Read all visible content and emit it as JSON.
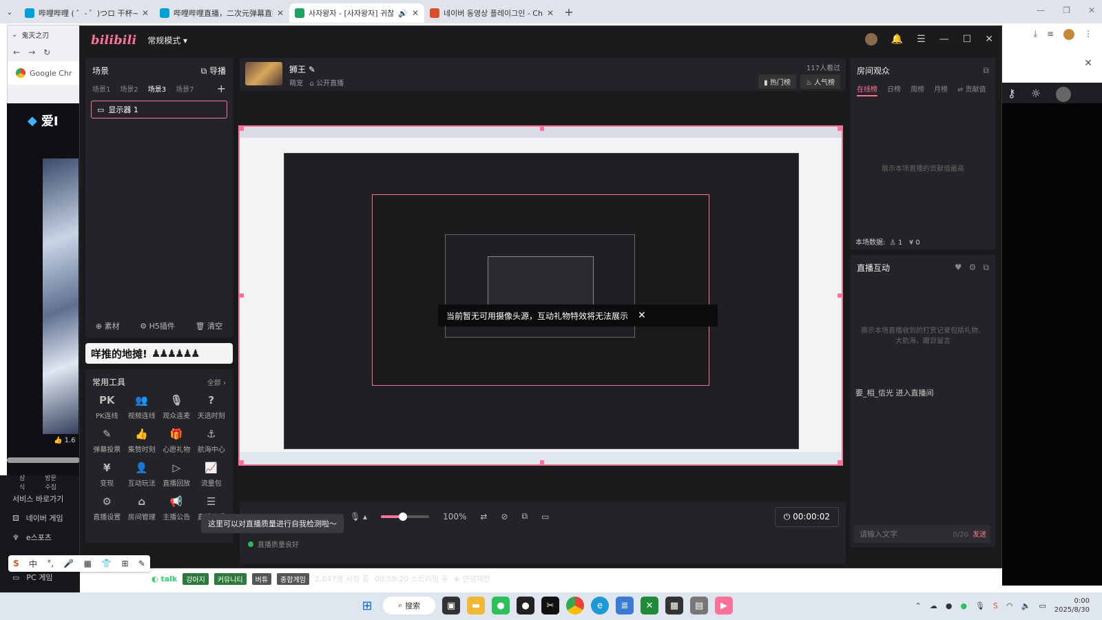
{
  "browser": {
    "tabs": [
      {
        "label": "哔哩哔哩 ( ゜- ゜)つロ 干杯~-b",
        "color": "#00a1d6"
      },
      {
        "label": "哔哩哔哩直播，二次元弹幕直播",
        "color": "#00a1d6"
      },
      {
        "label": "사자왕자 - [사자왕자] 귀찮",
        "color": "#1fa35c"
      },
      {
        "label": "네이버 동영상 플레이그인 - Chr",
        "color": "#d94f2b"
      }
    ],
    "inner_tab": "鬼灭之刃",
    "google_label": "Google Chr",
    "left_brand": "爱I"
  },
  "bg_nav": {
    "items": [
      "서비스 바로가기",
      "네이버 게임",
      "e스포츠",
      "PC 게임"
    ],
    "tabs": [
      "삼식",
      "방문수집"
    ],
    "likes": "1.6"
  },
  "bili": {
    "logo": "bilibili",
    "mode": "常规模式"
  },
  "scene": {
    "title": "场景",
    "guide": "导播",
    "tabs": [
      "场景1",
      "场景2",
      "场景3",
      "场景7"
    ],
    "active_tab": 2,
    "source": "显示器 1",
    "footer": [
      "素材",
      "H5插件",
      "清空"
    ]
  },
  "banner": {
    "text": "咩推的地摊!"
  },
  "tools": {
    "title": "常用工具",
    "all": "全部",
    "items": [
      {
        "label": "PK连线",
        "icon": "PK"
      },
      {
        "label": "视频连线",
        "icon": "👥"
      },
      {
        "label": "观众连麦",
        "icon": "🎙"
      },
      {
        "label": "天选时刻",
        "icon": "?"
      },
      {
        "label": "弹幕投票",
        "icon": "✎"
      },
      {
        "label": "集赞时刻",
        "icon": "👍"
      },
      {
        "label": "心愿礼物",
        "icon": "🎁"
      },
      {
        "label": "航海中心",
        "icon": "⚓"
      },
      {
        "label": "变现",
        "icon": "¥"
      },
      {
        "label": "互动玩法",
        "icon": "👤"
      },
      {
        "label": "直播回放",
        "icon": "▷"
      },
      {
        "label": "流量包",
        "icon": "📈"
      },
      {
        "label": "直播设置",
        "icon": "⚙"
      },
      {
        "label": "房间管理",
        "icon": "⌂"
      },
      {
        "label": "主播公告",
        "icon": "📢"
      },
      {
        "label": "直播助手",
        "icon": "☰"
      }
    ]
  },
  "stream": {
    "title": "狮王",
    "category": "萌宠",
    "visibility": "公开直播",
    "viewers": "117人看过",
    "hot_rank": "热门榜",
    "popularity": "人气榜"
  },
  "preview": {
    "toast": "当前暂无可用摄像头源，互动礼物特效将无法展示"
  },
  "controls": {
    "volume": "100%",
    "volume_level": 0.45,
    "timer": "00:00:02",
    "quality_tip": "这里可以对直播质量进行自我检测啦～",
    "quality_status": "直播质量良好"
  },
  "audience": {
    "title": "房间观众",
    "tabs": [
      "在线榜",
      "日榜",
      "周榜",
      "月榜",
      "贡献值"
    ],
    "empty": "展示本场直播的贡献值最高",
    "stats_label": "本场数据:",
    "stats_people": "1",
    "stats_coins": "0"
  },
  "interact": {
    "title": "直播互动",
    "empty": "展示本场直播收到的打赏记录包括礼物、大航海、醒目留言",
    "enter_msg": "要_相_信光 进入直播间",
    "input_placeholder": "请输入文字",
    "count": "0/20",
    "send": "发送"
  },
  "status_strip": {
    "brand": "talk",
    "chips": [
      "강아지",
      "커뮤니티",
      "버튜",
      "종합게임"
    ],
    "viewers": "2,047명 시청 중",
    "duration": "00:59:20 스트리밍 중",
    "age": "연령제한"
  },
  "ime": {
    "items": [
      "S",
      "中",
      "°,",
      "🎤",
      "▦",
      "👕",
      "⊞",
      "✎"
    ]
  },
  "taskbar": {
    "search": "搜索",
    "time": "0:00",
    "date": "2025/8/30"
  }
}
